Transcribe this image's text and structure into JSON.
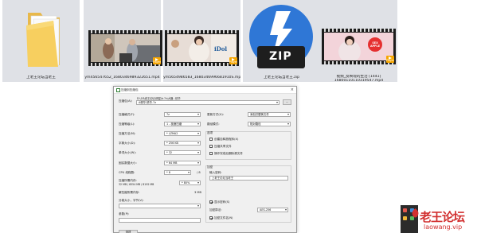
{
  "files": [
    {
      "name": "上老王论坛当老王",
      "type": "folder"
    },
    {
      "name": "ym456547652_1680346989322651.mp4",
      "type": "video"
    },
    {
      "name": "ym5654986583_1680346996681910S.mp4",
      "type": "video"
    },
    {
      "name": "上老王论坛当老王.zip",
      "type": "zip",
      "icon_text": "ZIP"
    },
    {
      "name": "视频_反映现的生活 [1441]\n16800110110319547.mp4",
      "type": "video",
      "line1": "视频_反映现的生活 [1441]",
      "line2": "16800110110319547.mp4"
    }
  ],
  "video_badge": "Player",
  "thumb_overlay_text": {
    "vid2": "iDol",
    "vid3": "SEX APPLE"
  },
  "zip_badge": "ZIP",
  "dialog": {
    "title": "压缩到压缩包",
    "archive_label": "压缩包(A):",
    "archive_path": "D:\\18\\老王论坛\\明星\\b.7z\\大疆...精华",
    "archive_name": "A精华 精华.7z",
    "browse": "...",
    "format_label": "压缩格式(F):",
    "format_value": "7z",
    "level_label": "压缩等级(L):",
    "level_value": "1 - 极速压缩",
    "method_label": "压缩方法(M):",
    "method_value": "* LZMA2",
    "dict_label": "字典大小(D):",
    "dict_value": "* 256 KB",
    "word_label": "单词大小(W):",
    "word_value": "* 32",
    "solid_label": "固实数据大小:",
    "solid_value": "* 64 MB",
    "cpu_label": "CPU 线程数:",
    "cpu_value": "* 8",
    "cpu_total": "/ 8",
    "mem_label": "压缩所需内存:",
    "mem_line2": "32 MB / 6554 MB / 8192 MB",
    "mem_value": "* 80%",
    "decomp_label": "解压缩所需内存:",
    "decomp_value": "3 MB",
    "split_label": "分卷大小，字节(V):",
    "params_label": "参数(P):",
    "update_label": "更新方式(U):",
    "update_value": "添加并替换文件",
    "pathmode_label": "路径模式:",
    "pathmode_value": "相对路径",
    "options_label": "选项",
    "opt1": "创建自释放程序(X)",
    "opt2": "压缩共享文件",
    "opt3": "操作完成后删除源文件",
    "encrypt_label": "加密",
    "password_label": "输入密码:",
    "password_value": "上老王论坛当老王",
    "show_pw": "显示密码(S)",
    "enc_method_label": "加密算法:",
    "enc_method_value": "AES-256",
    "encrypt_names": "加密文件名(N)",
    "options_button": "选项"
  },
  "watermark": {
    "line1": "老王论坛",
    "line2": "laowang.vip",
    "color": "#d23030"
  }
}
